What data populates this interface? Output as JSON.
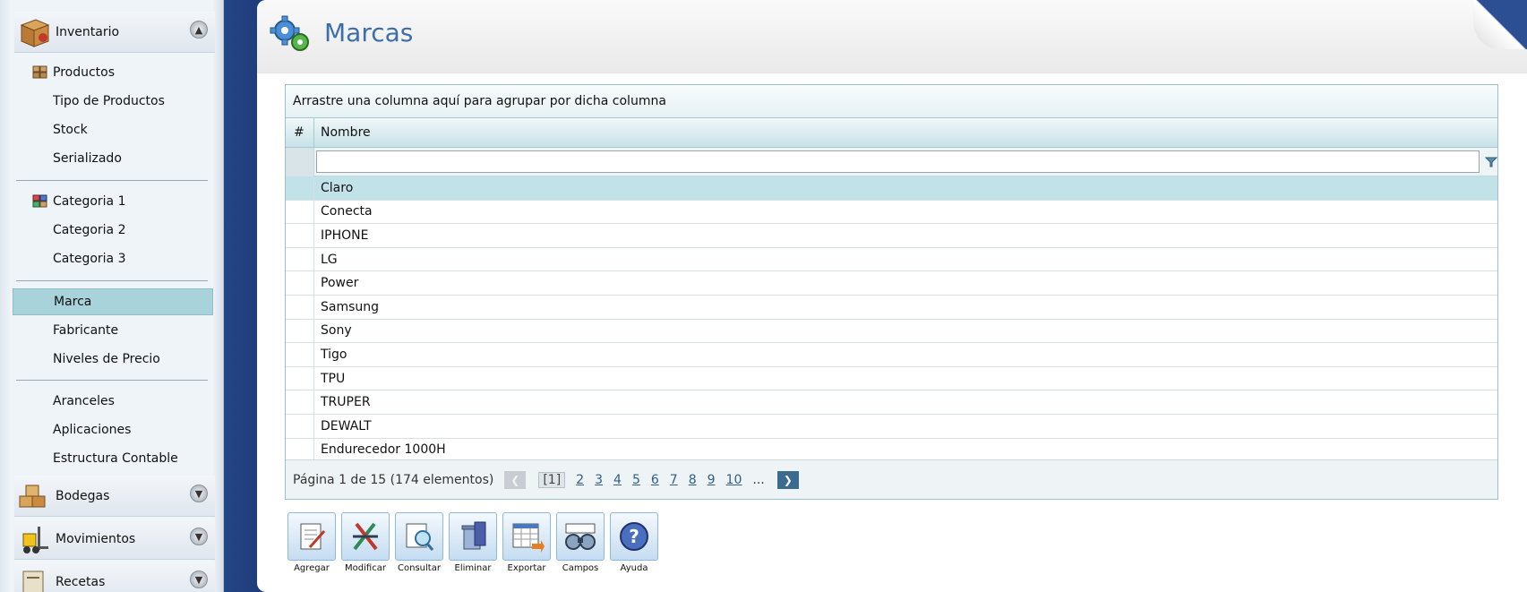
{
  "sidebar": {
    "groups": [
      {
        "label": "Inventario",
        "icon": "inventory-box-icon",
        "toggle": "collapse-up-icon"
      },
      {
        "label": "Bodegas",
        "icon": "warehouse-boxes-icon",
        "toggle": "expand-down-icon"
      },
      {
        "label": "Movimientos",
        "icon": "forklift-icon",
        "toggle": "expand-down-icon"
      },
      {
        "label": "Recetas",
        "icon": "recipe-icon",
        "toggle": "expand-down-icon"
      }
    ],
    "items": [
      {
        "label": "Productos",
        "icon": "products-icon"
      },
      {
        "label": "Tipo de Productos"
      },
      {
        "label": "Stock"
      },
      {
        "label": "Serializado"
      },
      {
        "label": "Categoria 1",
        "icon": "category-icon"
      },
      {
        "label": "Categoria 2"
      },
      {
        "label": "Categoria 3"
      },
      {
        "label": "Marca",
        "selected": true
      },
      {
        "label": "Fabricante"
      },
      {
        "label": "Niveles de Precio"
      },
      {
        "label": "Aranceles"
      },
      {
        "label": "Aplicaciones"
      },
      {
        "label": "Estructura Contable"
      }
    ]
  },
  "header": {
    "title": "Marcas",
    "icon": "gear-icon"
  },
  "grid": {
    "group_panel_text": "Arrastre una columna aquí para agrupar por dicha columna",
    "columns": [
      "#",
      "Nombre"
    ],
    "filter_value": "",
    "rows": [
      "Claro",
      "Conecta",
      "IPHONE",
      "LG",
      "Power",
      "Samsung",
      "Sony",
      "Tigo",
      "TPU",
      "TRUPER",
      "DEWALT",
      "Endurecedor 1000H"
    ],
    "selected_row": 0,
    "pager": {
      "summary": "Página 1 de 15 (174 elementos)",
      "current": "[1]",
      "pages": [
        "2",
        "3",
        "4",
        "5",
        "6",
        "7",
        "8",
        "9",
        "10"
      ],
      "ellipsis": "..."
    }
  },
  "toolbar": {
    "buttons": [
      {
        "label": "Agregar",
        "icon": "add-document-icon"
      },
      {
        "label": "Modificar",
        "icon": "edit-pencils-icon"
      },
      {
        "label": "Consultar",
        "icon": "search-magnifier-icon"
      },
      {
        "label": "Eliminar",
        "icon": "trash-icon"
      },
      {
        "label": "Exportar",
        "icon": "export-table-icon"
      },
      {
        "label": "Campos",
        "icon": "binoculars-icon"
      },
      {
        "label": "Ayuda",
        "icon": "help-icon"
      }
    ]
  }
}
